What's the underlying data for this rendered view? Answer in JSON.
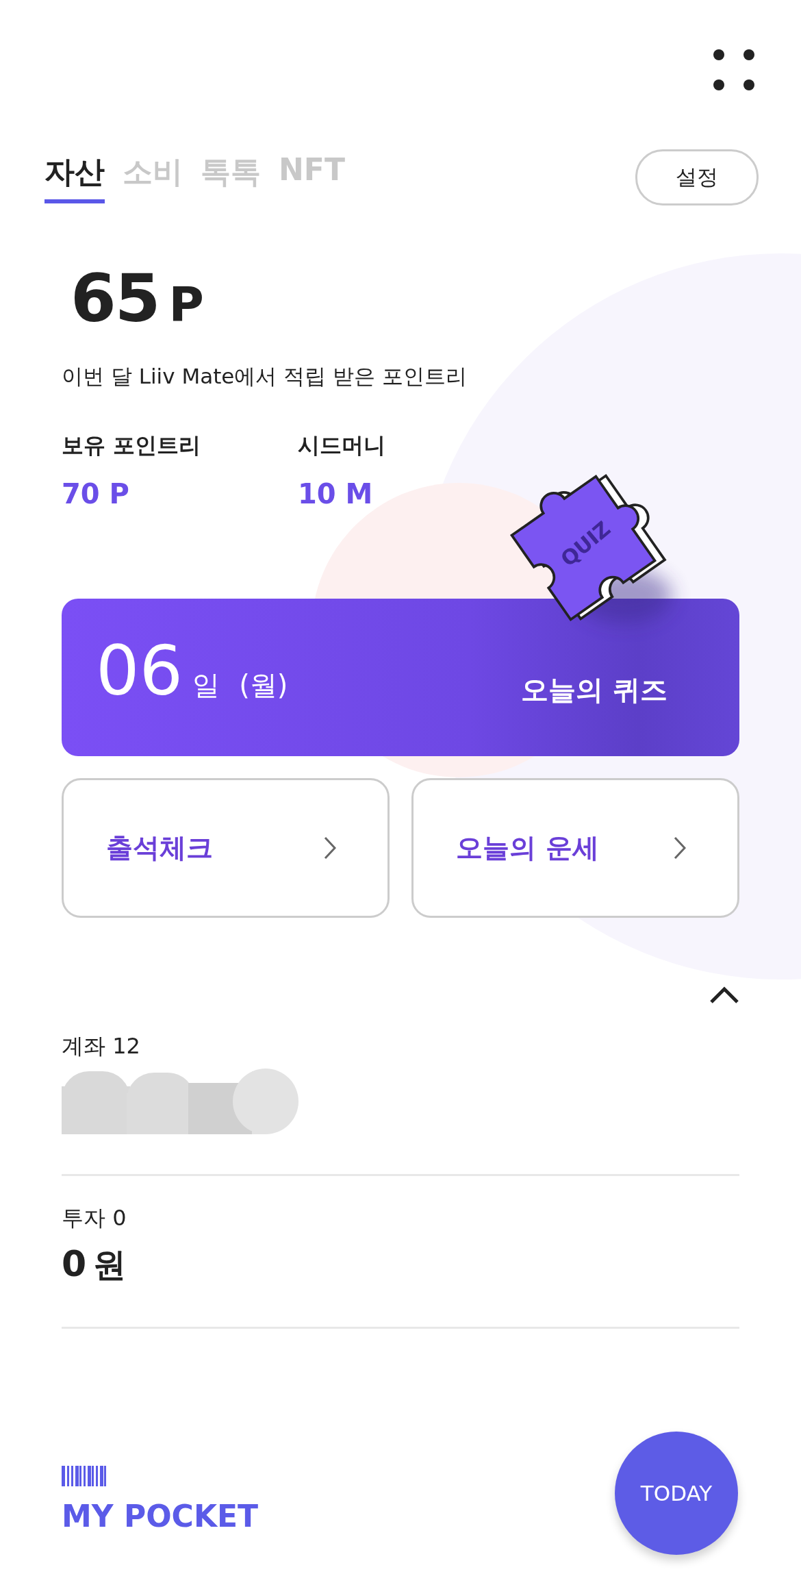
{
  "tabs": [
    {
      "label": "자산",
      "selected": true
    },
    {
      "label": "소비",
      "selected": false
    },
    {
      "label": "톡톡",
      "selected": false
    },
    {
      "label": "NFT",
      "selected": false
    }
  ],
  "settings_button": "설정",
  "points": {
    "value": "65",
    "unit": "P"
  },
  "points_caption": "이번 달 Liiv Mate에서 적립 받은 포인트리",
  "stats": [
    {
      "label": "보유 포인트리",
      "value": "70 P"
    },
    {
      "label": "시드머니",
      "value": "10 M"
    }
  ],
  "quiz_card": {
    "day": "06",
    "day_unit": "일",
    "weekday": "(월)",
    "title": "오늘의 퀴즈",
    "puzzle_label": "QUIZ"
  },
  "shortcuts": [
    "출석체크",
    "오늘의 운세"
  ],
  "sections": [
    {
      "kind": "redacted",
      "title": "계좌 12"
    },
    {
      "kind": "amount",
      "title": "투자 0",
      "amount": "0",
      "unit": "원"
    }
  ],
  "footer": {
    "pocket_label": "MY POCKET",
    "today_button": "TODAY"
  }
}
